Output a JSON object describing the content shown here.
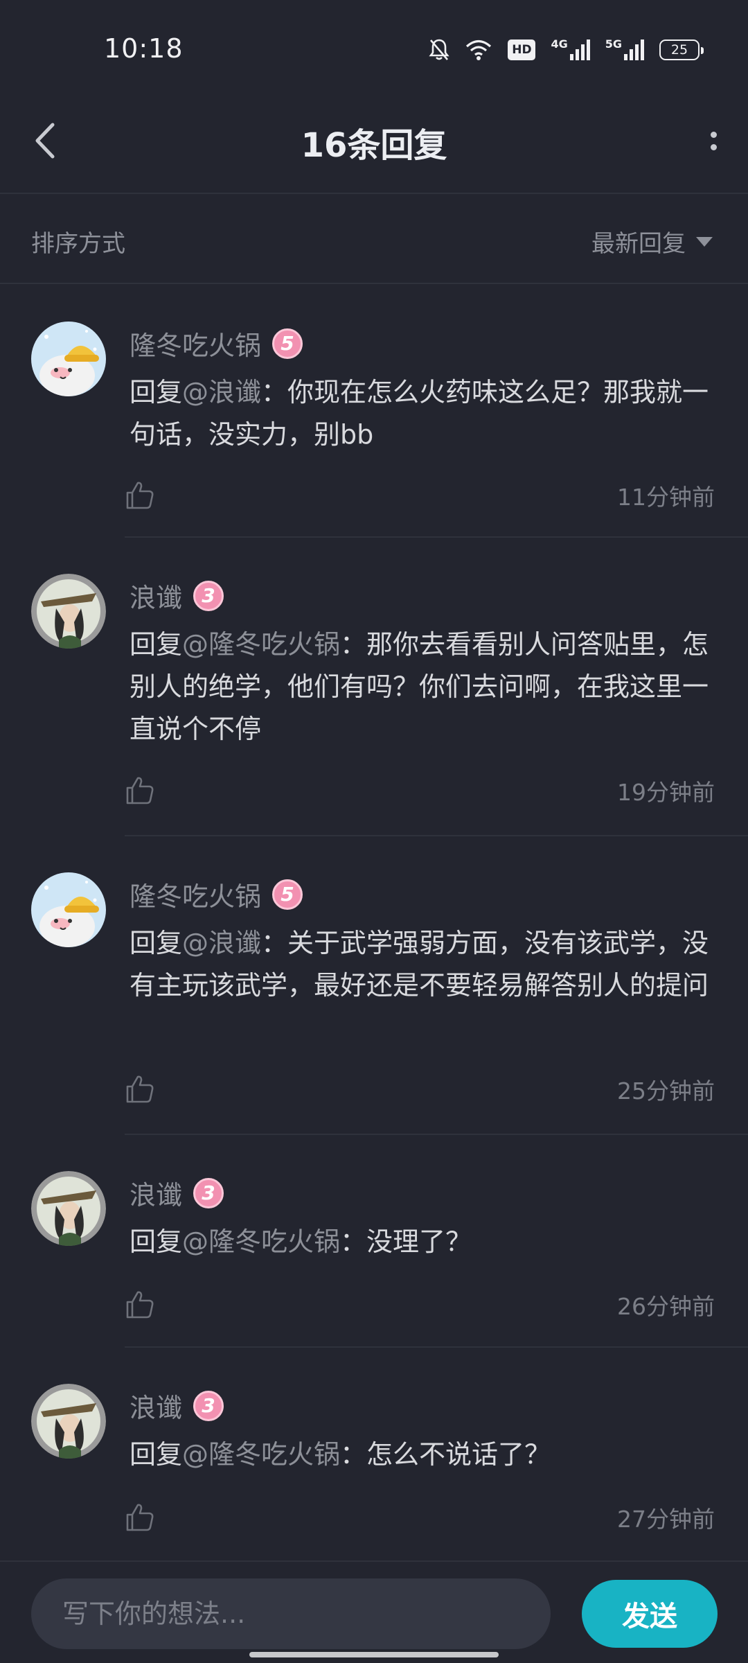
{
  "status_bar": {
    "time": "10:18",
    "network_1": "4G",
    "network_2": "5G",
    "hd_label": "HD",
    "battery": "25"
  },
  "header": {
    "title": "16条回复"
  },
  "sort": {
    "label": "排序方式",
    "selected": "最新回复"
  },
  "replies": [
    {
      "username": "隆冬吃火锅",
      "level": "5",
      "prefix": "回复",
      "mention": "@浪谶",
      "text": "：你现在怎么火药味这么足？那我就一句话，没实力，别bb",
      "time": "11分钟前"
    },
    {
      "username": "浪谶",
      "level": "3",
      "prefix": "回复",
      "mention": "@隆冬吃火锅",
      "text": "：那你去看看别人问答贴里，怎别人的绝学，他们有吗？你们去问啊，在我这里一直说个不停",
      "time": "19分钟前"
    },
    {
      "username": "隆冬吃火锅",
      "level": "5",
      "prefix": "回复",
      "mention": "@浪谶",
      "text": "：关于武学强弱方面，没有该武学，没有主玩该武学，最好还是不要轻易解答别人的提问",
      "time": "25分钟前"
    },
    {
      "username": "浪谶",
      "level": "3",
      "prefix": "回复",
      "mention": "@隆冬吃火锅",
      "text": "：没理了？",
      "time": "26分钟前"
    },
    {
      "username": "浪谶",
      "level": "3",
      "prefix": "回复",
      "mention": "@隆冬吃火锅",
      "text": "：怎么不说话了？",
      "time": "27分钟前"
    }
  ],
  "input": {
    "placeholder": "写下你的想法..."
  },
  "send_label": "发送",
  "colors": {
    "background": "#23252f",
    "send_button": "#18b3c4",
    "level_badge": "#f291b1"
  }
}
